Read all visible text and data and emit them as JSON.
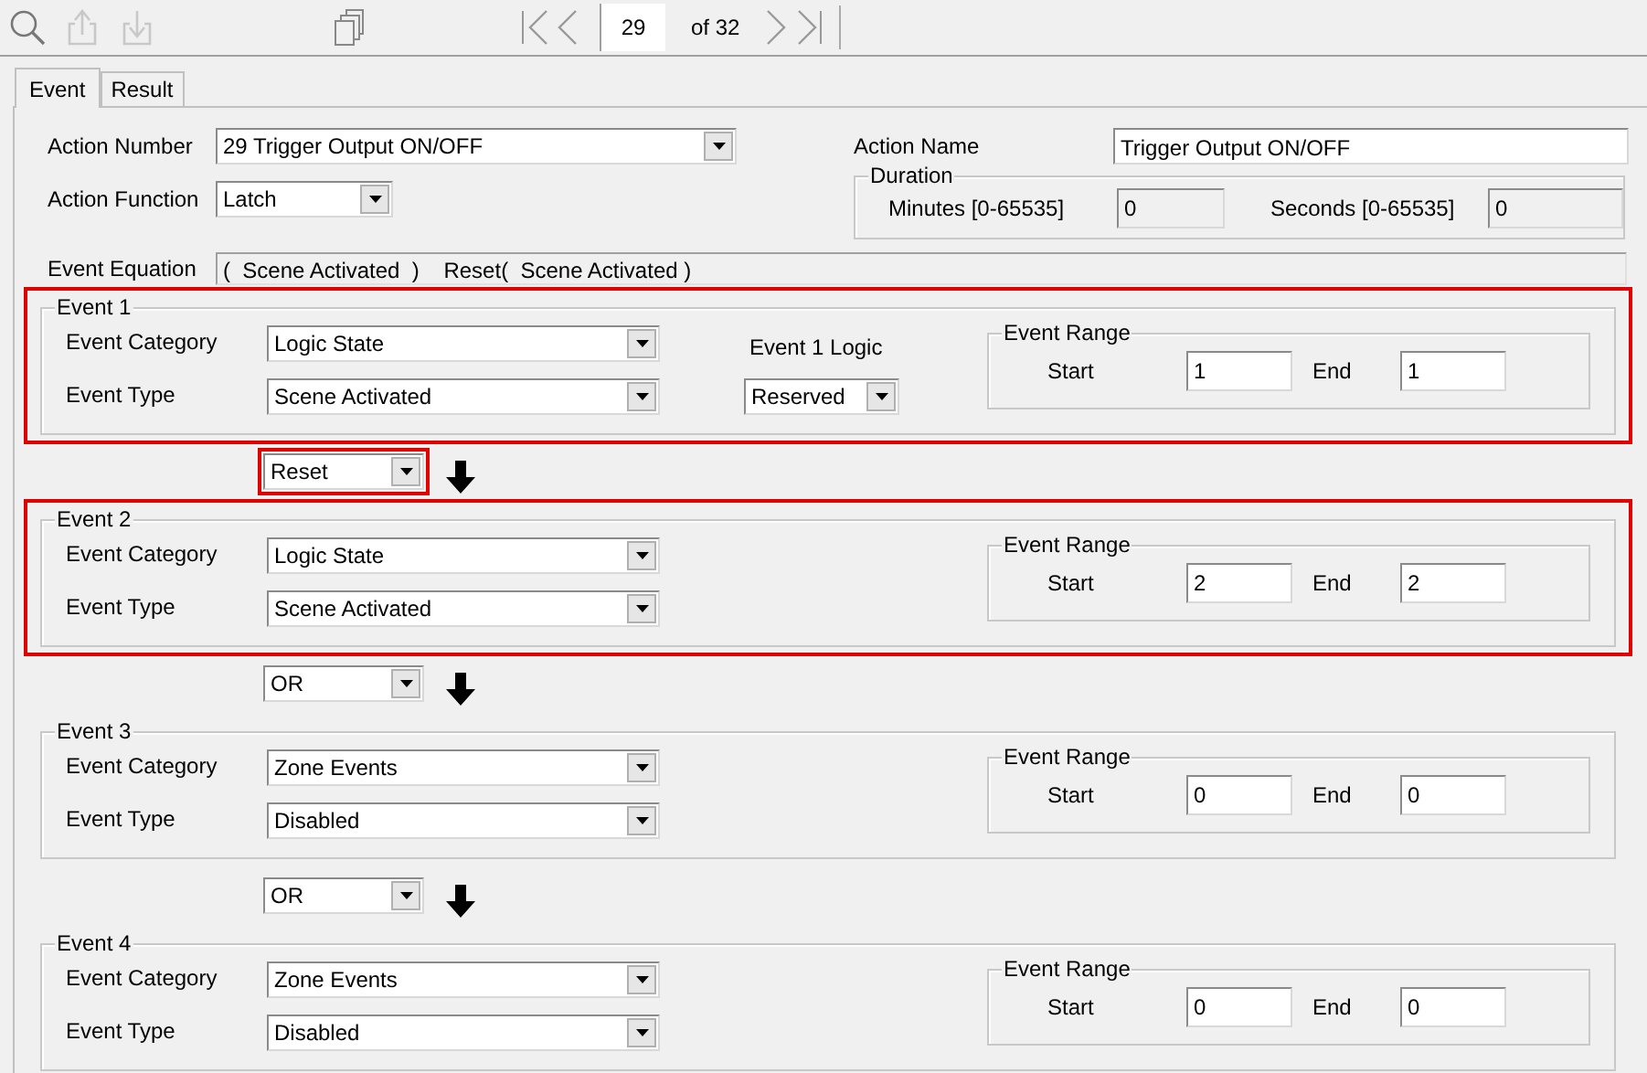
{
  "toolbar": {
    "page": "29",
    "page_count": "of 32"
  },
  "tabs": [
    {
      "label": "Event",
      "selected": true
    },
    {
      "label": "Result",
      "selected": false
    }
  ],
  "action": {
    "number_label": "Action Number",
    "number": "29 Trigger Output ON/OFF",
    "function_label": "Action Function",
    "function": "Latch",
    "name_label": "Action Name",
    "name": "Trigger Output ON/OFF",
    "duration": {
      "title": "Duration",
      "minutes_label": "Minutes  [0-65535]",
      "minutes": "0",
      "seconds_label": "Seconds  [0-65535]",
      "seconds": "0"
    },
    "equation_label": "Event Equation",
    "equation": "(  Scene Activated  )    Reset(  Scene Activated )"
  },
  "blocks": [
    {
      "kind": "event",
      "title": "Event 1",
      "highlighted": true,
      "category_label": "Event Category",
      "category": "Logic State",
      "type_label": "Event Type",
      "type": "Scene Activated",
      "logic_label": "Event 1 Logic",
      "logic": "Reserved",
      "range_title": "Event Range",
      "start_label": "Start",
      "start": "1",
      "end_label": "End",
      "end": "1"
    },
    {
      "kind": "connector",
      "value": "Reset",
      "highlighted": true
    },
    {
      "kind": "event",
      "title": "Event 2",
      "highlighted": true,
      "category_label": "Event Category",
      "category": "Logic State",
      "type_label": "Event Type",
      "type": "Scene Activated",
      "range_title": "Event Range",
      "start_label": "Start",
      "start": "2",
      "end_label": "End",
      "end": "2"
    },
    {
      "kind": "connector",
      "value": "OR",
      "highlighted": false
    },
    {
      "kind": "event",
      "title": "Event 3",
      "highlighted": false,
      "category_label": "Event Category",
      "category": "Zone Events",
      "type_label": "Event Type",
      "type": "Disabled",
      "range_title": "Event Range",
      "start_label": "Start",
      "start": "0",
      "end_label": "End",
      "end": "0"
    },
    {
      "kind": "connector",
      "value": "OR",
      "highlighted": false
    },
    {
      "kind": "event",
      "title": "Event 4",
      "highlighted": false,
      "category_label": "Event Category",
      "category": "Zone Events",
      "type_label": "Event Type",
      "type": "Disabled",
      "range_title": "Event Range",
      "start_label": "Start",
      "start": "0",
      "end_label": "End",
      "end": "0"
    }
  ]
}
